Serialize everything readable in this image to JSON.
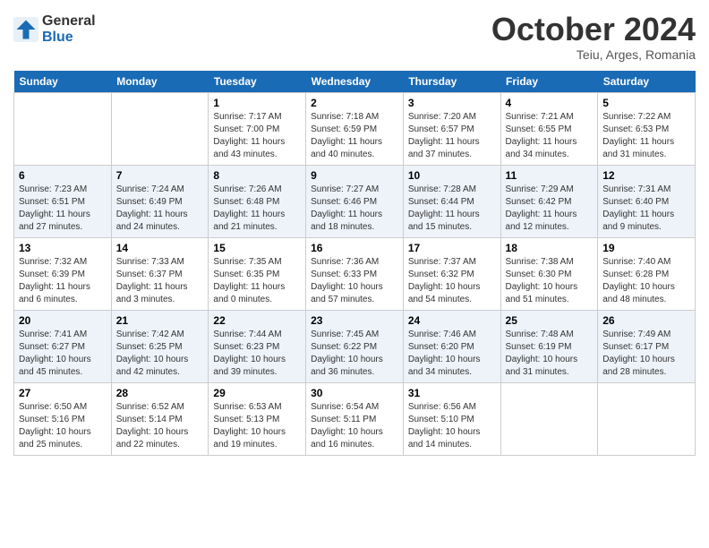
{
  "header": {
    "logo_line1": "General",
    "logo_line2": "Blue",
    "month": "October 2024",
    "location": "Teiu, Arges, Romania"
  },
  "columns": [
    "Sunday",
    "Monday",
    "Tuesday",
    "Wednesday",
    "Thursday",
    "Friday",
    "Saturday"
  ],
  "weeks": [
    [
      {
        "day": "",
        "info": ""
      },
      {
        "day": "",
        "info": ""
      },
      {
        "day": "1",
        "info": "Sunrise: 7:17 AM\nSunset: 7:00 PM\nDaylight: 11 hours and 43 minutes."
      },
      {
        "day": "2",
        "info": "Sunrise: 7:18 AM\nSunset: 6:59 PM\nDaylight: 11 hours and 40 minutes."
      },
      {
        "day": "3",
        "info": "Sunrise: 7:20 AM\nSunset: 6:57 PM\nDaylight: 11 hours and 37 minutes."
      },
      {
        "day": "4",
        "info": "Sunrise: 7:21 AM\nSunset: 6:55 PM\nDaylight: 11 hours and 34 minutes."
      },
      {
        "day": "5",
        "info": "Sunrise: 7:22 AM\nSunset: 6:53 PM\nDaylight: 11 hours and 31 minutes."
      }
    ],
    [
      {
        "day": "6",
        "info": "Sunrise: 7:23 AM\nSunset: 6:51 PM\nDaylight: 11 hours and 27 minutes."
      },
      {
        "day": "7",
        "info": "Sunrise: 7:24 AM\nSunset: 6:49 PM\nDaylight: 11 hours and 24 minutes."
      },
      {
        "day": "8",
        "info": "Sunrise: 7:26 AM\nSunset: 6:48 PM\nDaylight: 11 hours and 21 minutes."
      },
      {
        "day": "9",
        "info": "Sunrise: 7:27 AM\nSunset: 6:46 PM\nDaylight: 11 hours and 18 minutes."
      },
      {
        "day": "10",
        "info": "Sunrise: 7:28 AM\nSunset: 6:44 PM\nDaylight: 11 hours and 15 minutes."
      },
      {
        "day": "11",
        "info": "Sunrise: 7:29 AM\nSunset: 6:42 PM\nDaylight: 11 hours and 12 minutes."
      },
      {
        "day": "12",
        "info": "Sunrise: 7:31 AM\nSunset: 6:40 PM\nDaylight: 11 hours and 9 minutes."
      }
    ],
    [
      {
        "day": "13",
        "info": "Sunrise: 7:32 AM\nSunset: 6:39 PM\nDaylight: 11 hours and 6 minutes."
      },
      {
        "day": "14",
        "info": "Sunrise: 7:33 AM\nSunset: 6:37 PM\nDaylight: 11 hours and 3 minutes."
      },
      {
        "day": "15",
        "info": "Sunrise: 7:35 AM\nSunset: 6:35 PM\nDaylight: 11 hours and 0 minutes."
      },
      {
        "day": "16",
        "info": "Sunrise: 7:36 AM\nSunset: 6:33 PM\nDaylight: 10 hours and 57 minutes."
      },
      {
        "day": "17",
        "info": "Sunrise: 7:37 AM\nSunset: 6:32 PM\nDaylight: 10 hours and 54 minutes."
      },
      {
        "day": "18",
        "info": "Sunrise: 7:38 AM\nSunset: 6:30 PM\nDaylight: 10 hours and 51 minutes."
      },
      {
        "day": "19",
        "info": "Sunrise: 7:40 AM\nSunset: 6:28 PM\nDaylight: 10 hours and 48 minutes."
      }
    ],
    [
      {
        "day": "20",
        "info": "Sunrise: 7:41 AM\nSunset: 6:27 PM\nDaylight: 10 hours and 45 minutes."
      },
      {
        "day": "21",
        "info": "Sunrise: 7:42 AM\nSunset: 6:25 PM\nDaylight: 10 hours and 42 minutes."
      },
      {
        "day": "22",
        "info": "Sunrise: 7:44 AM\nSunset: 6:23 PM\nDaylight: 10 hours and 39 minutes."
      },
      {
        "day": "23",
        "info": "Sunrise: 7:45 AM\nSunset: 6:22 PM\nDaylight: 10 hours and 36 minutes."
      },
      {
        "day": "24",
        "info": "Sunrise: 7:46 AM\nSunset: 6:20 PM\nDaylight: 10 hours and 34 minutes."
      },
      {
        "day": "25",
        "info": "Sunrise: 7:48 AM\nSunset: 6:19 PM\nDaylight: 10 hours and 31 minutes."
      },
      {
        "day": "26",
        "info": "Sunrise: 7:49 AM\nSunset: 6:17 PM\nDaylight: 10 hours and 28 minutes."
      }
    ],
    [
      {
        "day": "27",
        "info": "Sunrise: 6:50 AM\nSunset: 5:16 PM\nDaylight: 10 hours and 25 minutes."
      },
      {
        "day": "28",
        "info": "Sunrise: 6:52 AM\nSunset: 5:14 PM\nDaylight: 10 hours and 22 minutes."
      },
      {
        "day": "29",
        "info": "Sunrise: 6:53 AM\nSunset: 5:13 PM\nDaylight: 10 hours and 19 minutes."
      },
      {
        "day": "30",
        "info": "Sunrise: 6:54 AM\nSunset: 5:11 PM\nDaylight: 10 hours and 16 minutes."
      },
      {
        "day": "31",
        "info": "Sunrise: 6:56 AM\nSunset: 5:10 PM\nDaylight: 10 hours and 14 minutes."
      },
      {
        "day": "",
        "info": ""
      },
      {
        "day": "",
        "info": ""
      }
    ]
  ]
}
